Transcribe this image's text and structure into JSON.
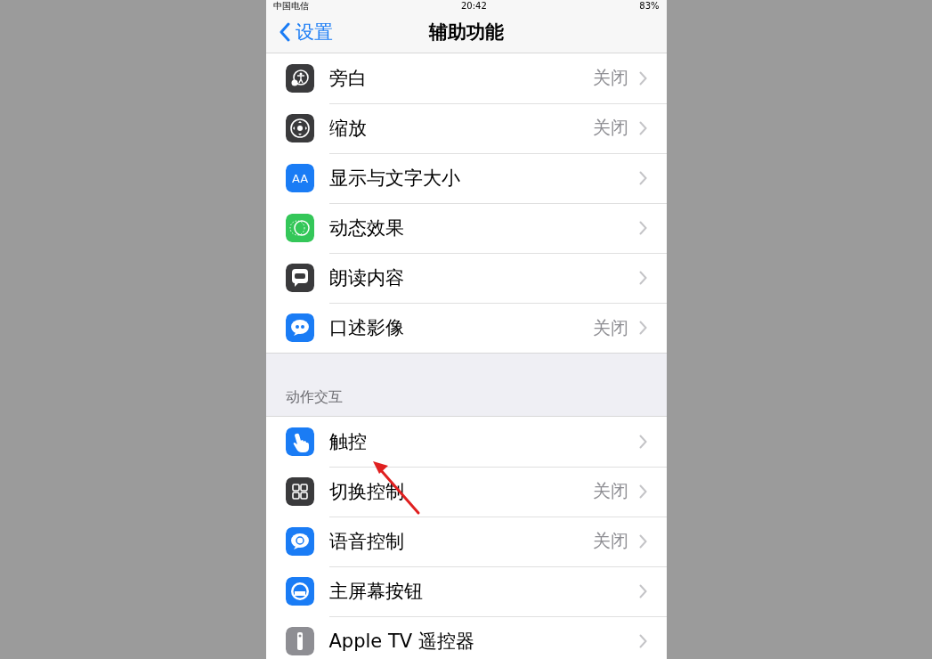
{
  "status_bar": {
    "carrier": "中国电信",
    "time": "20:42",
    "battery": "83%"
  },
  "nav_bar": {
    "back": "设置",
    "title": "辅助功能"
  },
  "groups": [
    {
      "rows": [
        {
          "kind": "voiceover",
          "color": "#3a3a3c",
          "label": "旁白",
          "value": "关闭"
        },
        {
          "kind": "zoom",
          "color": "#3a3a3c",
          "label": "缩放",
          "value": "关闭"
        },
        {
          "kind": "textsize",
          "color": "#1a7cf5",
          "icon_text": "AA",
          "label": "显示与文字大小"
        },
        {
          "kind": "motion",
          "color": "#34c759",
          "label": "动态效果"
        },
        {
          "kind": "speech",
          "color": "#3a3a3c",
          "label": "朗读内容"
        },
        {
          "kind": "quote",
          "color": "#1a7cf5",
          "label": "口述影像",
          "value": "关闭"
        }
      ]
    },
    {
      "header": "动作交互",
      "rows": [
        {
          "kind": "hand",
          "color": "#1a7cf5",
          "label": "触控"
        },
        {
          "kind": "grid",
          "color": "#3a3a3c",
          "label": "切换控制",
          "value": "关闭"
        },
        {
          "kind": "voice",
          "color": "#1a7cf5",
          "label": "语音控制",
          "value": "关闭"
        },
        {
          "kind": "home",
          "color": "#1a7cf5",
          "label": "主屏幕按钮"
        },
        {
          "kind": "remote",
          "color": "#8e8e93",
          "label": "Apple TV 遥控器"
        }
      ]
    }
  ]
}
